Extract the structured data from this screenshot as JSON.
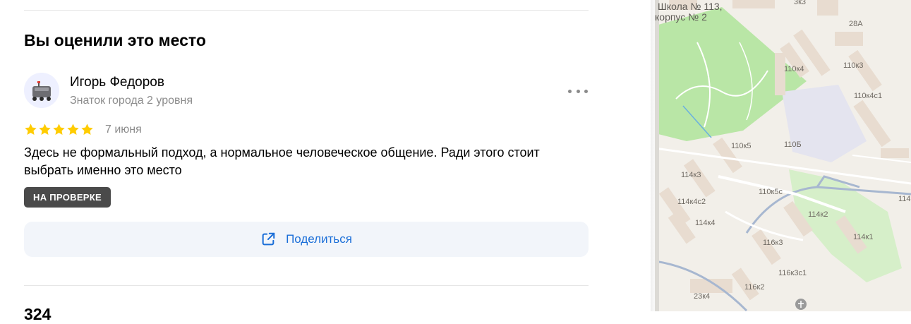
{
  "review_section": {
    "title": "Вы оценили это место",
    "user": {
      "name": "Игорь Федоров",
      "level": "Знаток города 2 уровня"
    },
    "rating": 5,
    "max_rating": 5,
    "date": "7 июня",
    "text": "Здесь не формальный подход, а нормальное человеческое общение. Ради этого стоит выбрать именно это место",
    "status_badge": "НА ПРОВЕРКЕ",
    "share_label": "Поделиться",
    "next_title": "324"
  },
  "map": {
    "labels": [
      "Школа № 113,",
      "корпус № 2",
      "3к3",
      "28А",
      "110к4",
      "110к3",
      "110к4с1",
      "110к5",
      "110Б",
      "114к3",
      "110к5с",
      "114к4с2",
      "114к2",
      "114к4",
      "114к1",
      "116к3",
      "116к3с1",
      "23к4",
      "116к2",
      "114"
    ]
  },
  "colors": {
    "accent": "#1a6ed8",
    "star": "#fc0",
    "badge_bg": "#4a4a4a",
    "share_bg": "#f2f5fa",
    "park": "#b9e6a6"
  }
}
